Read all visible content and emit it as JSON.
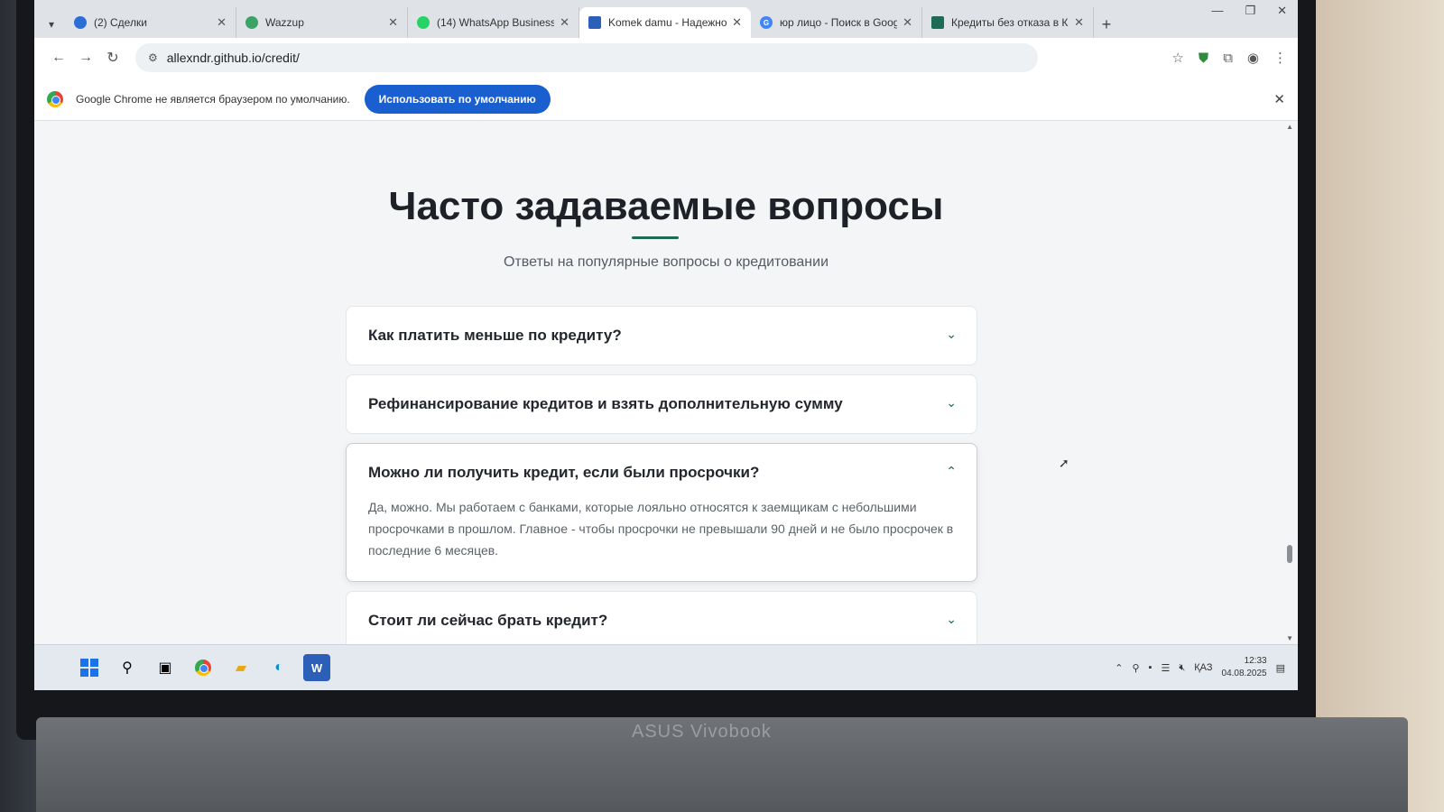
{
  "tabs": [
    {
      "label": "(2) Сделки",
      "favicon_color": "#2b6fd6",
      "active": false
    },
    {
      "label": "Wazzup",
      "favicon_color": "#3aa365",
      "active": false
    },
    {
      "label": "(14) WhatsApp Business",
      "favicon_color": "#25d366",
      "active": false
    },
    {
      "label": "Komek damu - Надежное",
      "favicon_color": "#2b5fb8",
      "active": true
    },
    {
      "label": "юр лицо - Поиск в Google",
      "favicon_color": "#4285f4",
      "active": false
    },
    {
      "label": "Кредиты без отказа в Ка",
      "favicon_color": "#1d6b54",
      "active": false
    }
  ],
  "address_bar": {
    "url": "allexndr.github.io/credit/"
  },
  "infobar": {
    "message": "Google Chrome не является браузером по умолчанию.",
    "button_label": "Использовать по умолчанию"
  },
  "faq": {
    "title": "Часто задаваемые вопросы",
    "subtitle": "Ответы на популярные вопросы о кредитовании",
    "items": [
      {
        "question": "Как платить меньше по кредиту?",
        "answer": "",
        "open": false
      },
      {
        "question": "Рефинансирование кредитов и взять дополнительную сумму",
        "answer": "",
        "open": false
      },
      {
        "question": "Можно ли получить кредит, если были просрочки?",
        "answer": "Да, можно. Мы работаем с банками, которые лояльно относятся к заемщикам с небольшими просрочками в прошлом. Главное - чтобы просрочки не превышали 90 дней и не было просрочек в последние 6 месяцев.",
        "open": true
      },
      {
        "question": "Стоит ли сейчас брать кредит?",
        "answer": "",
        "open": false
      }
    ]
  },
  "taskbar": {
    "tray_language": "ҚАЗ",
    "time": "12:33",
    "date": "04.08.2025"
  },
  "laptop_brand": "ASUS Vivobook",
  "colors": {
    "accent": "#1d6b54",
    "infobar_button": "#1a5fd0"
  }
}
